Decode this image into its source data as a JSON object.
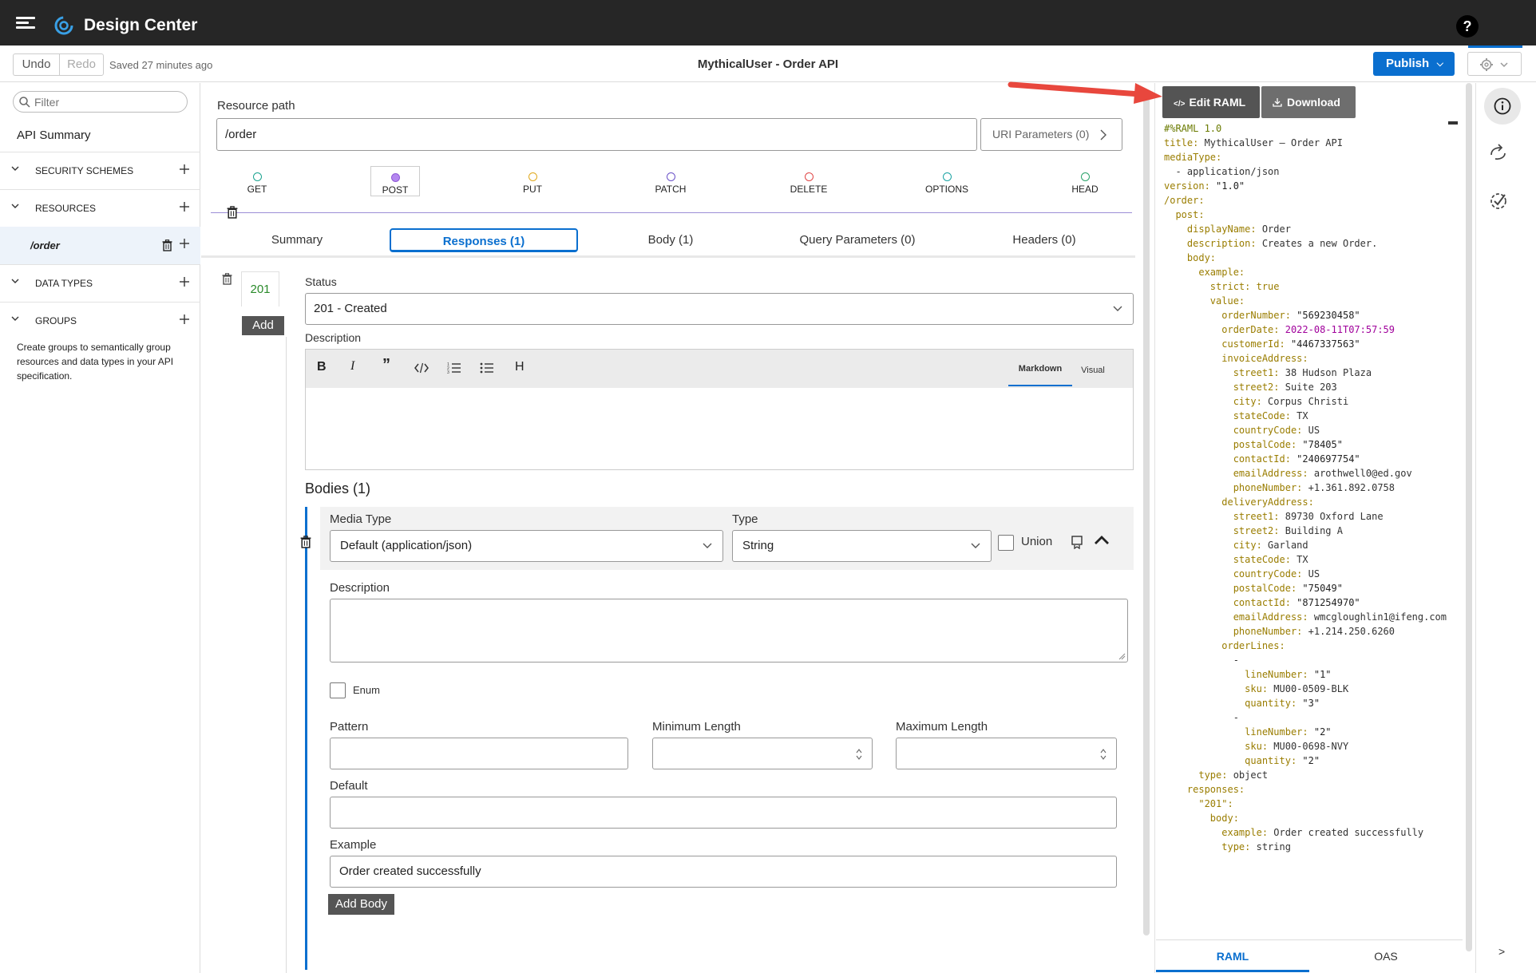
{
  "header": {
    "app_title": "Design Center",
    "help": "?"
  },
  "toolbar": {
    "undo": "Undo",
    "redo": "Redo",
    "saved": "Saved 27 minutes ago",
    "api_name": "MythicalUser - Order API",
    "publish": "Publish"
  },
  "sidebar": {
    "filter_placeholder": "Filter",
    "api_summary": "API Summary",
    "sections": {
      "security": "SECURITY SCHEMES",
      "resources": "RESOURCES",
      "data_types": "DATA TYPES",
      "groups": "GROUPS"
    },
    "resource_item": "/order",
    "groups_help": "Create groups to semantically group resources and data types in your API specification."
  },
  "main": {
    "resource_path_label": "Resource path",
    "resource_path_value": "/order",
    "uri_parameters": "URI Parameters (0)",
    "methods": [
      {
        "label": "GET",
        "color": "#1aa38f"
      },
      {
        "label": "POST",
        "color": "#8f5ad6"
      },
      {
        "label": "PUT",
        "color": "#e0a81c"
      },
      {
        "label": "PATCH",
        "color": "#6b53c9"
      },
      {
        "label": "DELETE",
        "color": "#e04646"
      },
      {
        "label": "OPTIONS",
        "color": "#1aa3a3"
      },
      {
        "label": "HEAD",
        "color": "#2aa36a"
      }
    ],
    "active_method": "POST",
    "tabs": [
      "Summary",
      "Responses (1)",
      "Body (1)",
      "Query Parameters (0)",
      "Headers (0)"
    ],
    "active_tab": "Responses (1)",
    "response": {
      "code": "201",
      "add_label": "Add",
      "status_label": "Status",
      "status_value": "201 - Created",
      "description_label": "Description",
      "editor_modes": {
        "markdown": "Markdown",
        "visual": "Visual"
      },
      "bodies_title": "Bodies (1)",
      "body": {
        "media_type_label": "Media Type",
        "media_type_value": "Default (application/json)",
        "type_label": "Type",
        "type_value": "String",
        "union_label": "Union",
        "description_label": "Description",
        "enum_label": "Enum",
        "pattern_label": "Pattern",
        "min_length_label": "Minimum Length",
        "max_length_label": "Maximum Length",
        "default_label": "Default",
        "example_label": "Example",
        "example_value": "Order created successfully"
      },
      "add_body": "Add Body"
    }
  },
  "raml_panel": {
    "edit_raml": "Edit RAML",
    "download": "Download",
    "tabs": {
      "raml": "RAML",
      "oas": "OAS"
    },
    "code_lines": [
      [
        [
          "c",
          "#%RAML 1.0"
        ]
      ],
      [
        [
          "k",
          "title: "
        ],
        [
          "v",
          "MythicalUser – Order API"
        ]
      ],
      [
        [
          "k",
          "mediaType:"
        ]
      ],
      [
        [
          "v",
          "  - application/json"
        ]
      ],
      [
        [
          "k",
          "version: "
        ],
        [
          "s",
          "\"1.0\""
        ]
      ],
      [
        [
          "k",
          "/order:"
        ]
      ],
      [
        [
          "k",
          "  post:"
        ]
      ],
      [
        [
          "k",
          "    displayName: "
        ],
        [
          "v",
          "Order"
        ]
      ],
      [
        [
          "k",
          "    description: "
        ],
        [
          "v",
          "Creates a new Order."
        ]
      ],
      [
        [
          "k",
          "    body:"
        ]
      ],
      [
        [
          "k",
          "      example:"
        ]
      ],
      [
        [
          "k",
          "        strict: "
        ],
        [
          "k",
          "true"
        ]
      ],
      [
        [
          "k",
          "        value:"
        ]
      ],
      [
        [
          "k",
          "          orderNumber: "
        ],
        [
          "s",
          "\"569230458\""
        ]
      ],
      [
        [
          "k",
          "          orderDate: "
        ],
        [
          "d",
          "2022-08-11T07:57:59"
        ]
      ],
      [
        [
          "k",
          "          customerId: "
        ],
        [
          "s",
          "\"4467337563\""
        ]
      ],
      [
        [
          "k",
          "          invoiceAddress:"
        ]
      ],
      [
        [
          "k",
          "            street1: "
        ],
        [
          "v",
          "38 Hudson Plaza"
        ]
      ],
      [
        [
          "k",
          "            street2: "
        ],
        [
          "v",
          "Suite 203"
        ]
      ],
      [
        [
          "k",
          "            city: "
        ],
        [
          "v",
          "Corpus Christi"
        ]
      ],
      [
        [
          "k",
          "            stateCode: "
        ],
        [
          "v",
          "TX"
        ]
      ],
      [
        [
          "k",
          "            countryCode: "
        ],
        [
          "v",
          "US"
        ]
      ],
      [
        [
          "k",
          "            postalCode: "
        ],
        [
          "s",
          "\"78405\""
        ]
      ],
      [
        [
          "k",
          "            contactId: "
        ],
        [
          "s",
          "\"240697754\""
        ]
      ],
      [
        [
          "k",
          "            emailAddress: "
        ],
        [
          "v",
          "arothwell0@ed.gov"
        ]
      ],
      [
        [
          "k",
          "            phoneNumber: "
        ],
        [
          "v",
          "+1.361.892.0758"
        ]
      ],
      [
        [
          "k",
          "          deliveryAddress:"
        ]
      ],
      [
        [
          "k",
          "            street1: "
        ],
        [
          "v",
          "89730 Oxford Lane"
        ]
      ],
      [
        [
          "k",
          "            street2: "
        ],
        [
          "v",
          "Building A"
        ]
      ],
      [
        [
          "k",
          "            city: "
        ],
        [
          "v",
          "Garland"
        ]
      ],
      [
        [
          "k",
          "            stateCode: "
        ],
        [
          "v",
          "TX"
        ]
      ],
      [
        [
          "k",
          "            countryCode: "
        ],
        [
          "v",
          "US"
        ]
      ],
      [
        [
          "k",
          "            postalCode: "
        ],
        [
          "s",
          "\"75049\""
        ]
      ],
      [
        [
          "k",
          "            contactId: "
        ],
        [
          "s",
          "\"871254970\""
        ]
      ],
      [
        [
          "k",
          "            emailAddress: "
        ],
        [
          "v",
          "wmcgloughlin1@ifeng.com"
        ]
      ],
      [
        [
          "k",
          "            phoneNumber: "
        ],
        [
          "v",
          "+1.214.250.6260"
        ]
      ],
      [
        [
          "k",
          "          orderLines:"
        ]
      ],
      [
        [
          "p",
          "            -"
        ]
      ],
      [
        [
          "k",
          "              lineNumber: "
        ],
        [
          "s",
          "\"1\""
        ]
      ],
      [
        [
          "k",
          "              sku: "
        ],
        [
          "v",
          "MU00-0509-BLK"
        ]
      ],
      [
        [
          "k",
          "              quantity: "
        ],
        [
          "s",
          "\"3\""
        ]
      ],
      [
        [
          "p",
          "            -"
        ]
      ],
      [
        [
          "k",
          "              lineNumber: "
        ],
        [
          "s",
          "\"2\""
        ]
      ],
      [
        [
          "k",
          "              sku: "
        ],
        [
          "v",
          "MU00-0698-NVY"
        ]
      ],
      [
        [
          "k",
          "              quantity: "
        ],
        [
          "s",
          "\"2\""
        ]
      ],
      [
        [
          "k",
          "      type: "
        ],
        [
          "v",
          "object"
        ]
      ],
      [
        [
          "k",
          "    responses:"
        ]
      ],
      [
        [
          "k",
          "      \"201\":"
        ]
      ],
      [
        [
          "k",
          "        body:"
        ]
      ],
      [
        [
          "k",
          "          example: "
        ],
        [
          "v",
          "Order created successfully"
        ]
      ],
      [
        [
          "k",
          "          type: "
        ],
        [
          "v",
          "string"
        ]
      ]
    ]
  }
}
